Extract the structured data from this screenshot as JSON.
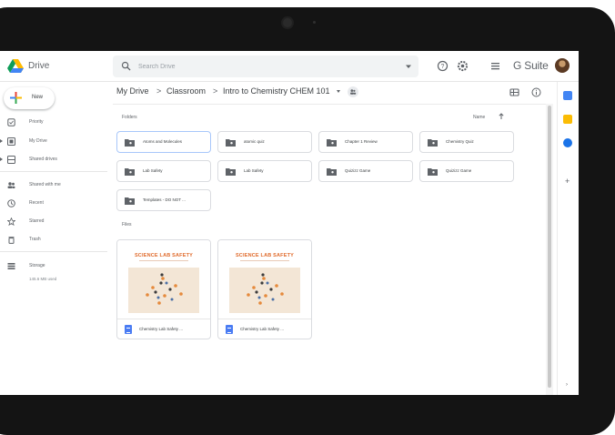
{
  "app": {
    "title": "Drive",
    "brand": "G Suite"
  },
  "search": {
    "placeholder": "Search Drive"
  },
  "nav": {
    "new_label": "New",
    "items": [
      {
        "label": "Priority",
        "icon": "priority-icon"
      },
      {
        "label": "My Drive",
        "icon": "my-drive-icon"
      },
      {
        "label": "Shared drives",
        "icon": "shared-drives-icon"
      },
      {
        "label": "Shared with me",
        "icon": "shared-with-me-icon"
      },
      {
        "label": "Recent",
        "icon": "clock-icon"
      },
      {
        "label": "Starred",
        "icon": "star-icon"
      },
      {
        "label": "Trash",
        "icon": "trash-icon"
      },
      {
        "label": "Storage",
        "icon": "storage-icon"
      }
    ],
    "storage_used": "145.6 MB used"
  },
  "breadcrumb": [
    "My Drive",
    "Classroom",
    "Intro to Chemistry CHEM 101"
  ],
  "breadcrumb_sep": ">",
  "main": {
    "folders_label": "Folders",
    "sort_label": "Name",
    "files_label": "Files",
    "folders": [
      "Atoms and Molecules",
      "atomic quiz",
      "Chapter 1 Review",
      "Chemistry Quiz",
      "Lab Safety",
      "Lab Safety",
      "Quizizz Game",
      "Quizizz Game",
      "Templates - DO NOT ..."
    ],
    "files": [
      {
        "name": "Chemistry Lab Safety ...",
        "thumb_title": "SCIENCE LAB SAFETY"
      },
      {
        "name": "Chemistry Lab Safety ...",
        "thumb_title": "SCIENCE LAB SAFETY"
      }
    ]
  },
  "colors": {
    "selected_border": "#a8c7fa",
    "doc_blue": "#4a7cf3",
    "thumb_orange": "#e06b2c",
    "thumb_bg": "#f3e6d6"
  }
}
